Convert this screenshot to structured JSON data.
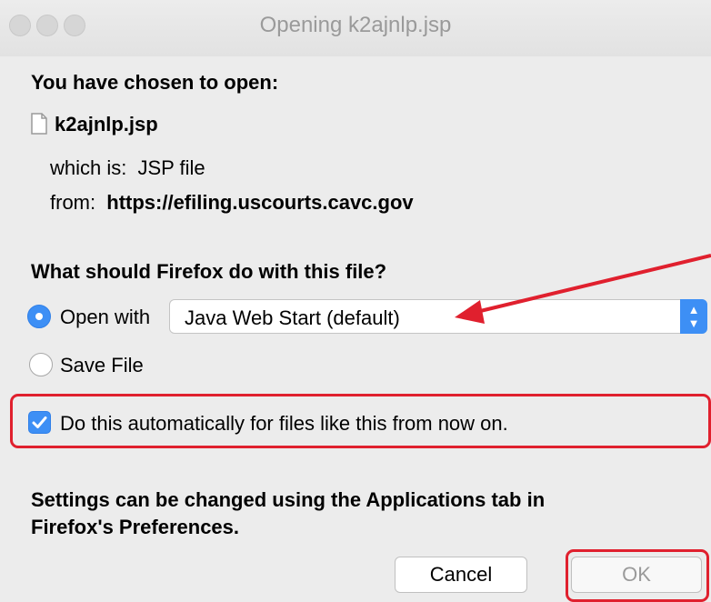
{
  "window": {
    "title": "Opening k2ajnlp.jsp"
  },
  "dialog": {
    "heading": "You have chosen to open:",
    "file_name": "k2ajnlp.jsp",
    "type_label": "which is:",
    "type_value": "JSP file",
    "from_label": "from:",
    "from_value": "https://efiling.uscourts.cavc.gov",
    "question": "What should Firefox do with this file?",
    "open_with_label": "Open with",
    "open_with_selected": "Java Web Start (default)",
    "save_file_label": "Save File",
    "auto_label": "Do this automatically for files like this from now on.",
    "settings_line1": "Settings can be changed using the Applications tab in",
    "settings_line2": "Firefox's Preferences.",
    "cancel_label": "Cancel",
    "ok_label": "OK"
  },
  "state": {
    "open_with_checked": true,
    "save_file_checked": false,
    "auto_checked": true
  },
  "annotations": {
    "highlight_color": "#e0202e",
    "radio_accent": "#3d8ff5"
  }
}
